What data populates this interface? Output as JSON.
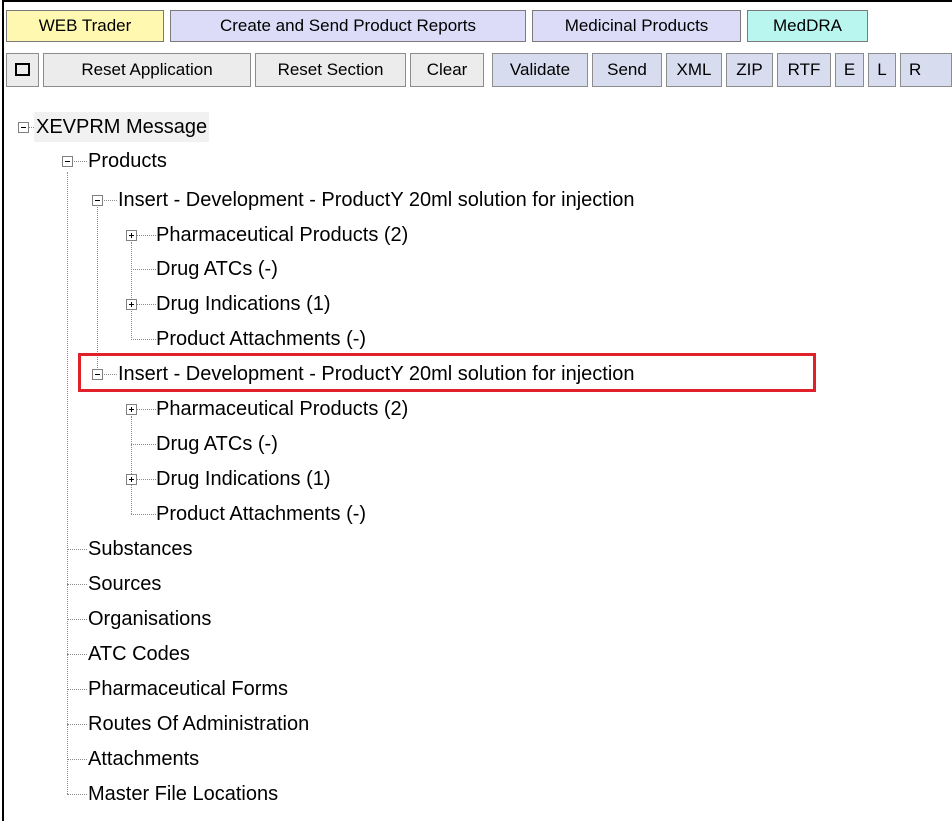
{
  "tabs": [
    {
      "label": "WEB Trader",
      "color": "#fff8b0"
    },
    {
      "label": "Create and Send Product Reports",
      "color": "#dcdcf8"
    },
    {
      "label": "Medicinal Products",
      "color": "#dcdcf8"
    },
    {
      "label": "MedDRA",
      "color": "#b9f6f0"
    }
  ],
  "toolbar": {
    "window_icon": "square-window-icon",
    "buttons": [
      "Reset Application",
      "Reset Section",
      "Clear",
      "Validate",
      "Send",
      "XML",
      "ZIP",
      "RTF",
      "E",
      "L",
      "R"
    ]
  },
  "tree": {
    "root": "XEVPRM Message",
    "products": "Products",
    "product_1": {
      "label": "Insert - Development - ProductY 20ml solution for injection",
      "children": [
        "Pharmaceutical Products (2)",
        "Drug ATCs (-)",
        "Drug Indications (1)",
        "Product Attachments (-)"
      ]
    },
    "product_2": {
      "label": "Insert - Development - ProductY 20ml solution for injection",
      "children": [
        "Pharmaceutical Products (2)",
        "Drug ATCs (-)",
        "Drug Indications (1)",
        "Product Attachments (-)"
      ]
    },
    "sections": [
      "Substances",
      "Sources",
      "Organisations",
      "ATC Codes",
      "Pharmaceutical Forms",
      "Routes Of Administration",
      "Attachments",
      "Master File Locations"
    ]
  },
  "colors": {
    "highlight": "#e0202a",
    "toolbar_group": "#d7dcef"
  }
}
